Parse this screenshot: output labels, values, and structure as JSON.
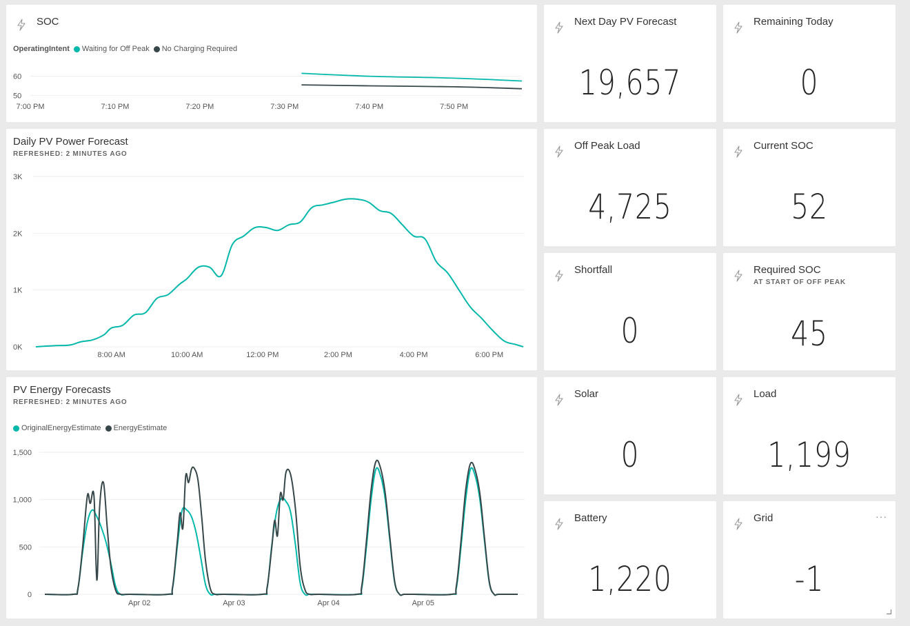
{
  "colors": {
    "teal": "#01b8aa",
    "dark": "#374649",
    "tile_bg": "#ffffff",
    "page_bg": "#eaeaea"
  },
  "icons": {
    "tile_icon": "lightning-bolt-icon"
  },
  "soc_tile": {
    "title": "SOC",
    "legend_label": "OperatingIntent",
    "legend": [
      "Waiting for Off Peak",
      "No Charging Required"
    ],
    "chart_data": {
      "type": "line",
      "x_ticks": [
        "7:00 PM",
        "7:10 PM",
        "7:20 PM",
        "7:30 PM",
        "7:40 PM",
        "7:50 PM"
      ],
      "y_ticks": [
        "60",
        "50"
      ],
      "ylim": [
        48,
        62
      ],
      "x_range_minutes": [
        0,
        58
      ],
      "series": [
        {
          "name": "Waiting for Off Peak",
          "x": [
            32,
            40,
            50,
            58
          ],
          "values": [
            61.5,
            60.0,
            59.0,
            57.5
          ]
        },
        {
          "name": "No Charging Required",
          "x": [
            32,
            40,
            50,
            58
          ],
          "values": [
            55.5,
            55.0,
            54.5,
            53.5
          ]
        }
      ]
    }
  },
  "pv_power_tile": {
    "title": "Daily PV Power Forecast",
    "subtitle": "REFRESHED: 2 MINUTES AGO",
    "chart_data": {
      "type": "line",
      "x_ticks": [
        "8:00 AM",
        "10:00 AM",
        "12:00 PM",
        "2:00 PM",
        "4:00 PM",
        "6:00 PM"
      ],
      "x_tick_hours": [
        8,
        10,
        12,
        14,
        16,
        18
      ],
      "y_ticks": [
        "3K",
        "2K",
        "1K",
        "0K"
      ],
      "y_tick_values": [
        3000,
        2000,
        1000,
        0
      ],
      "ylim": [
        0,
        3000
      ],
      "xlim": [
        6.0,
        18.9
      ],
      "series": [
        {
          "x": [
            6.0,
            6.5,
            6.9,
            7.2,
            7.5,
            7.8,
            8.0,
            8.3,
            8.6,
            8.9,
            9.2,
            9.5,
            9.8,
            10.0,
            10.3,
            10.6,
            10.9,
            11.2,
            11.5,
            11.8,
            12.1,
            12.4,
            12.7,
            13.0,
            13.3,
            13.6,
            13.9,
            14.2,
            14.5,
            14.8,
            15.1,
            15.4,
            15.7,
            16.0,
            16.3,
            16.6,
            16.9,
            17.2,
            17.5,
            17.8,
            18.1,
            18.4,
            18.7,
            18.9
          ],
          "values": [
            0,
            20,
            30,
            90,
            120,
            210,
            330,
            380,
            560,
            600,
            850,
            920,
            1100,
            1200,
            1400,
            1400,
            1250,
            1800,
            1950,
            2100,
            2100,
            2050,
            2150,
            2200,
            2450,
            2500,
            2550,
            2600,
            2600,
            2550,
            2400,
            2350,
            2150,
            1950,
            1900,
            1500,
            1300,
            1000,
            700,
            500,
            280,
            100,
            40,
            0
          ]
        }
      ]
    }
  },
  "pv_energy_tile": {
    "title": "PV Energy Forecasts",
    "subtitle": "REFRESHED: 2 MINUTES AGO",
    "legend": [
      "OriginalEnergyEstimate",
      "EnergyEstimate"
    ],
    "chart_data": {
      "type": "line",
      "x_ticks": [
        "Apr 02",
        "Apr 03",
        "Apr 04",
        "Apr 05"
      ],
      "x_tick_days": [
        1,
        2,
        3,
        4
      ],
      "y_ticks": [
        "1,500",
        "1,000",
        "500",
        "0"
      ],
      "y_tick_values": [
        1500,
        1000,
        500,
        0
      ],
      "ylim": [
        0,
        1500
      ],
      "xlim": [
        0.0,
        5.0
      ],
      "series": [
        {
          "name": "OriginalEnergyEstimate",
          "x": [
            0,
            0.3,
            0.35,
            0.4,
            0.45,
            0.5,
            0.55,
            0.6,
            0.65,
            0.7,
            0.75,
            0.8,
            0.9,
            1.3,
            1.35,
            1.4,
            1.45,
            1.5,
            1.55,
            1.6,
            1.65,
            1.7,
            1.75,
            1.8,
            1.9,
            2.3,
            2.35,
            2.4,
            2.45,
            2.5,
            2.55,
            2.6,
            2.65,
            2.7,
            2.75,
            2.8,
            2.9,
            3.3,
            3.35,
            3.4,
            3.45,
            3.5,
            3.55,
            3.6,
            3.65,
            3.7,
            3.75,
            3.8,
            3.9,
            4.3,
            4.35,
            4.4,
            4.45,
            4.5,
            4.55,
            4.6,
            4.65,
            4.7,
            4.75,
            4.8,
            5.0
          ],
          "values": [
            0,
            0,
            60,
            450,
            760,
            890,
            820,
            700,
            540,
            320,
            80,
            0,
            0,
            0,
            60,
            500,
            880,
            890,
            820,
            650,
            380,
            100,
            0,
            0,
            0,
            0,
            60,
            520,
            870,
            1010,
            980,
            860,
            520,
            120,
            0,
            0,
            0,
            0,
            60,
            500,
            1000,
            1320,
            1250,
            1000,
            550,
            120,
            0,
            0,
            0,
            0,
            60,
            500,
            1000,
            1320,
            1250,
            1000,
            550,
            120,
            0,
            0,
            0
          ]
        },
        {
          "name": "EnergyEstimate",
          "x": [
            0,
            0.3,
            0.35,
            0.4,
            0.45,
            0.48,
            0.52,
            0.55,
            0.58,
            0.62,
            0.66,
            0.7,
            0.75,
            0.8,
            0.9,
            1.3,
            1.35,
            1.4,
            1.43,
            1.46,
            1.49,
            1.52,
            1.55,
            1.58,
            1.62,
            1.66,
            1.7,
            1.75,
            1.8,
            1.9,
            2.3,
            2.35,
            2.4,
            2.43,
            2.46,
            2.49,
            2.52,
            2.55,
            2.6,
            2.65,
            2.7,
            2.75,
            2.8,
            2.9,
            3.3,
            3.35,
            3.4,
            3.45,
            3.5,
            3.55,
            3.6,
            3.65,
            3.7,
            3.75,
            3.8,
            3.9,
            4.3,
            4.35,
            4.4,
            4.45,
            4.5,
            4.55,
            4.6,
            4.65,
            4.7,
            4.75,
            4.8,
            5.0
          ],
          "values": [
            0,
            0,
            60,
            500,
            1040,
            960,
            1040,
            150,
            930,
            1180,
            700,
            280,
            40,
            0,
            0,
            0,
            70,
            550,
            860,
            700,
            1250,
            1180,
            1320,
            1330,
            1200,
            800,
            350,
            60,
            0,
            0,
            0,
            70,
            500,
            780,
            620,
            1060,
            1000,
            1290,
            1260,
            900,
            300,
            50,
            0,
            0,
            0,
            80,
            560,
            1100,
            1400,
            1330,
            1060,
            580,
            130,
            0,
            0,
            0,
            0,
            80,
            560,
            1100,
            1380,
            1310,
            1060,
            580,
            130,
            0,
            0,
            0
          ]
        }
      ]
    }
  },
  "kpis": {
    "next_day": {
      "title": "Next Day PV Forecast",
      "value": "19,657"
    },
    "remaining": {
      "title": "Remaining Today",
      "value": "0"
    },
    "off_peak": {
      "title": "Off Peak Load",
      "value": "4,725"
    },
    "current_soc": {
      "title": "Current SOC",
      "value": "52"
    },
    "shortfall": {
      "title": "Shortfall",
      "value": "0"
    },
    "required_soc": {
      "title": "Required SOC",
      "subtitle": "AT START OF OFF PEAK",
      "value": "45"
    },
    "solar": {
      "title": "Solar",
      "value": "0"
    },
    "load": {
      "title": "Load",
      "value": "1,199"
    },
    "battery": {
      "title": "Battery",
      "value": "1,220"
    },
    "grid": {
      "title": "Grid",
      "value": "-1",
      "more": "···"
    }
  }
}
